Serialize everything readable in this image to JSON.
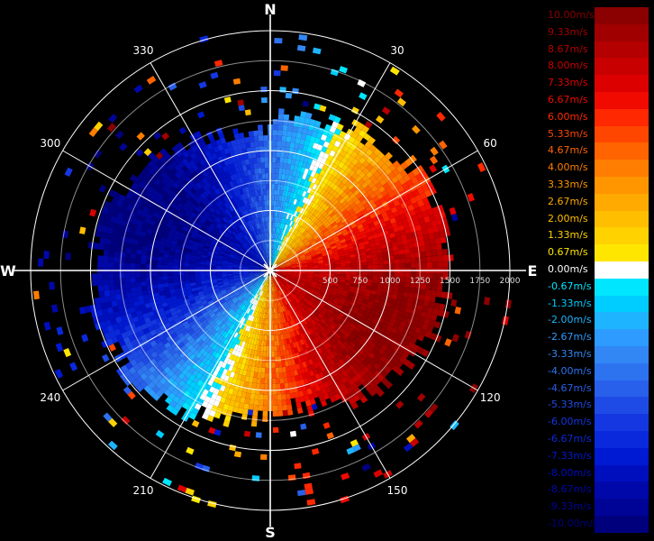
{
  "radar": {
    "compass": {
      "n": "N",
      "s": "S",
      "e": "E",
      "w": "W"
    },
    "bearings": [
      {
        "label": "30",
        "angle": 30
      },
      {
        "label": "60",
        "angle": 60
      },
      {
        "label": "120",
        "angle": 120
      },
      {
        "label": "150",
        "angle": 150
      },
      {
        "label": "210",
        "angle": 210
      },
      {
        "label": "240",
        "angle": 240
      },
      {
        "label": "300",
        "angle": 300
      },
      {
        "label": "330",
        "angle": 330
      }
    ],
    "range_labels": [
      "500",
      "750",
      "1000",
      "1250",
      "1500",
      "1750",
      "2000"
    ],
    "range_max": 2000,
    "wind": {
      "from_deg": 115,
      "max_speed_ms": 10
    }
  },
  "legend": {
    "items": [
      {
        "label": "10.00m/s",
        "color": "#8b0000"
      },
      {
        "label": "9.33m/s",
        "color": "#a00000"
      },
      {
        "label": "8.67m/s",
        "color": "#b40000"
      },
      {
        "label": "8.00m/s",
        "color": "#c80000"
      },
      {
        "label": "7.33m/s",
        "color": "#dc0000"
      },
      {
        "label": "6.67m/s",
        "color": "#f00a00"
      },
      {
        "label": "6.00m/s",
        "color": "#ff2800"
      },
      {
        "label": "5.33m/s",
        "color": "#ff4600"
      },
      {
        "label": "4.67m/s",
        "color": "#ff6400"
      },
      {
        "label": "4.00m/s",
        "color": "#ff7d00"
      },
      {
        "label": "3.33m/s",
        "color": "#ff9600"
      },
      {
        "label": "2.67m/s",
        "color": "#ffaa00"
      },
      {
        "label": "2.00m/s",
        "color": "#ffbe00"
      },
      {
        "label": "1.33m/s",
        "color": "#ffd200"
      },
      {
        "label": "0.67m/s",
        "color": "#ffe600"
      },
      {
        "label": "0.00m/s",
        "color": "#ffffff"
      },
      {
        "label": "-0.67m/s",
        "color": "#00e6ff"
      },
      {
        "label": "-1.33m/s",
        "color": "#00cdff"
      },
      {
        "label": "-2.00m/s",
        "color": "#1eb4ff"
      },
      {
        "label": "-2.67m/s",
        "color": "#2d9bff"
      },
      {
        "label": "-3.33m/s",
        "color": "#3287f5"
      },
      {
        "label": "-4.00m/s",
        "color": "#2d73f0"
      },
      {
        "label": "-4.67m/s",
        "color": "#285feb"
      },
      {
        "label": "-5.33m/s",
        "color": "#1e4be6"
      },
      {
        "label": "-6.00m/s",
        "color": "#1437e1"
      },
      {
        "label": "-6.67m/s",
        "color": "#0a28dc"
      },
      {
        "label": "-7.33m/s",
        "color": "#0019d2"
      },
      {
        "label": "-8.00m/s",
        "color": "#000fbe"
      },
      {
        "label": "-8.67m/s",
        "color": "#0008aa"
      },
      {
        "label": "-9.33m/s",
        "color": "#000496"
      },
      {
        "label": "-10.00m/s",
        "color": "#00007d"
      }
    ]
  }
}
